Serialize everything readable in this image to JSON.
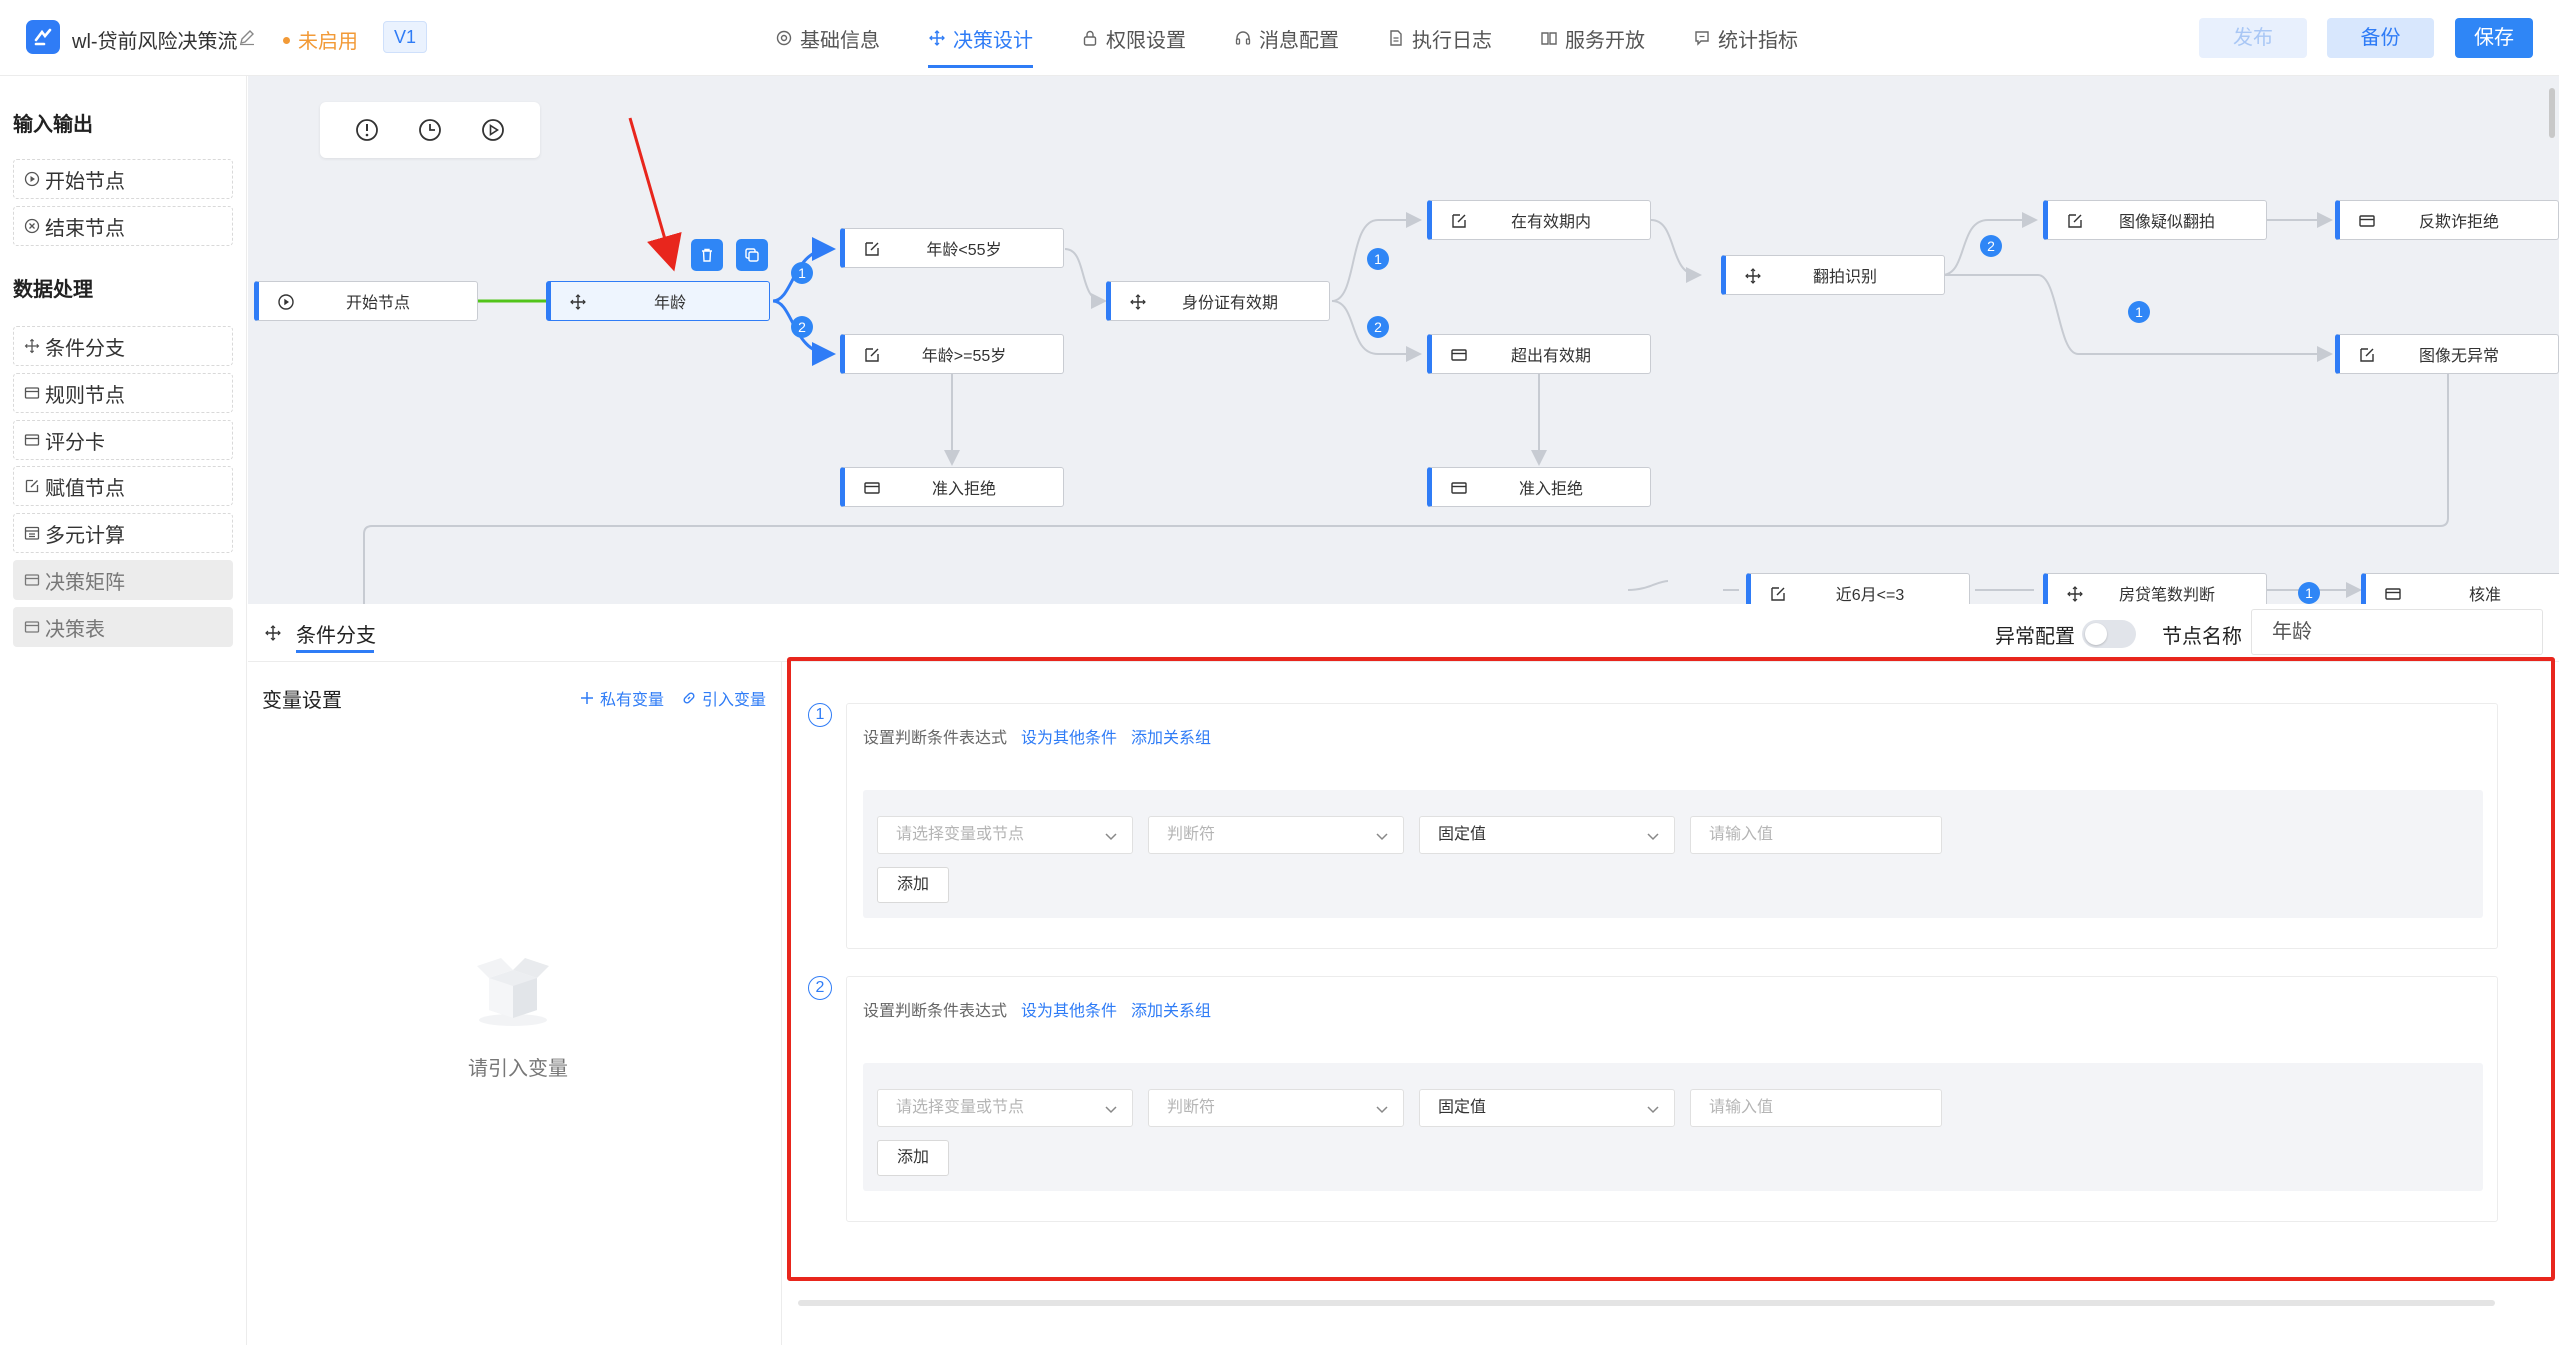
{
  "header": {
    "app_title": "wl-贷前风险决策流",
    "status": "未启用",
    "version": "V1",
    "tabs": [
      {
        "label": "基础信息",
        "icon": "gear-icon"
      },
      {
        "label": "决策设计",
        "icon": "move-icon",
        "active": true
      },
      {
        "label": "权限设置",
        "icon": "lock-icon"
      },
      {
        "label": "消息配置",
        "icon": "headset-icon"
      },
      {
        "label": "执行日志",
        "icon": "document-icon"
      },
      {
        "label": "服务开放",
        "icon": "book-icon"
      },
      {
        "label": "统计指标",
        "icon": "chat-icon"
      }
    ],
    "buttons": {
      "publish": "发布",
      "backup": "备份",
      "save": "保存"
    },
    "colors": {
      "accent": "#2f7cf6",
      "status": "#f29a37",
      "highlight_frame": "#e8261d"
    }
  },
  "sidebar": {
    "groups": [
      {
        "title": "输入输出",
        "items": [
          {
            "label": "开始节点",
            "icon": "play-circle-icon"
          },
          {
            "label": "结束节点",
            "icon": "stop-circle-icon"
          }
        ]
      },
      {
        "title": "数据处理",
        "items": [
          {
            "label": "条件分支",
            "icon": "move-icon"
          },
          {
            "label": "规则节点",
            "icon": "card-icon"
          },
          {
            "label": "评分卡",
            "icon": "card-icon"
          },
          {
            "label": "赋值节点",
            "icon": "edit-icon"
          },
          {
            "label": "多元计算",
            "icon": "calendar-icon"
          },
          {
            "label": "决策矩阵",
            "icon": "card-icon",
            "disabled": true
          },
          {
            "label": "决策表",
            "icon": "card-icon",
            "disabled": true
          }
        ]
      }
    ]
  },
  "canvas": {
    "toolbar": [
      {
        "name": "info-icon"
      },
      {
        "name": "history-icon"
      },
      {
        "name": "run-icon"
      }
    ],
    "nodes": [
      {
        "id": "start",
        "label": "开始节点",
        "icon": "play-circle-icon"
      },
      {
        "id": "age",
        "label": "年龄",
        "icon": "move-icon",
        "selected": true
      },
      {
        "id": "age_lt55",
        "label": "年龄<55岁",
        "icon": "edit-icon"
      },
      {
        "id": "age_ge55",
        "label": "年龄>=55岁",
        "icon": "edit-icon"
      },
      {
        "id": "reject1",
        "label": "准入拒绝",
        "icon": "card-icon"
      },
      {
        "id": "id_valid",
        "label": "身份证有效期",
        "icon": "move-icon"
      },
      {
        "id": "in_valid",
        "label": "在有效期内",
        "icon": "edit-icon"
      },
      {
        "id": "expired",
        "label": "超出有效期",
        "icon": "card-icon"
      },
      {
        "id": "reject2",
        "label": "准入拒绝",
        "icon": "card-icon"
      },
      {
        "id": "recapture",
        "label": "翻拍识别",
        "icon": "move-icon"
      },
      {
        "id": "suspect",
        "label": "图像疑似翻拍",
        "icon": "edit-icon"
      },
      {
        "id": "antifraud",
        "label": "反欺诈拒绝",
        "icon": "card-icon"
      },
      {
        "id": "img_ok",
        "label": "图像无异常",
        "icon": "edit-icon"
      },
      {
        "id": "six_month",
        "label": "近6月<=3",
        "icon": "edit-icon"
      },
      {
        "id": "mortgage",
        "label": "房贷笔数判断",
        "icon": "move-icon"
      },
      {
        "id": "approve",
        "label": "核准",
        "icon": "card-icon"
      }
    ],
    "branch_badges": [
      "1",
      "2",
      "1",
      "2",
      "2",
      "1",
      "1"
    ]
  },
  "panel": {
    "tab_label": "条件分支",
    "anomaly_label": "异常配置",
    "anomaly_enabled": false,
    "node_name_label": "节点名称",
    "node_name_value": "年龄",
    "variables": {
      "title": "变量设置",
      "private_var": "私有变量",
      "import_var": "引入变量",
      "empty_text": "请引入变量"
    },
    "conditions": [
      {
        "index": "1",
        "headline": "设置判断条件表达式",
        "set_other": "设为其他条件",
        "add_group": "添加关系组",
        "var_placeholder": "请选择变量或节点",
        "op_placeholder": "判断符",
        "type_value": "固定值",
        "value_placeholder": "请输入值",
        "add_label": "添加"
      },
      {
        "index": "2",
        "headline": "设置判断条件表达式",
        "set_other": "设为其他条件",
        "add_group": "添加关系组",
        "var_placeholder": "请选择变量或节点",
        "op_placeholder": "判断符",
        "type_value": "固定值",
        "value_placeholder": "请输入值",
        "add_label": "添加"
      }
    ]
  }
}
